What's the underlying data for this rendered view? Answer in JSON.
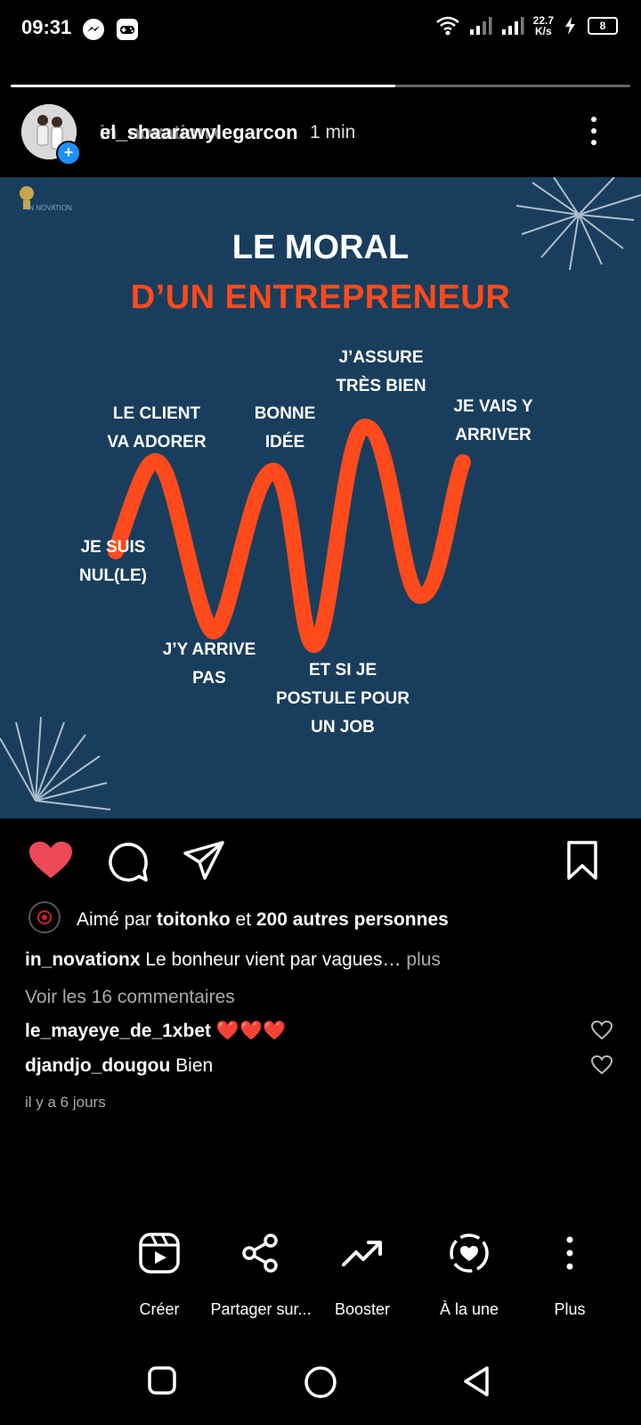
{
  "status_bar": {
    "time": "09:31",
    "speed_value": "22.7",
    "speed_unit": "K/s",
    "battery": "8",
    "left_icons": [
      "messenger-icon",
      "game-controller-icon"
    ],
    "right_icons": [
      "wifi-icon",
      "signal-icon",
      "signal-icon",
      "charging-icon",
      "battery-icon"
    ]
  },
  "story": {
    "progress": 0.62
  },
  "header": {
    "username": "el_shaarawylegarcon",
    "username_overlap": "in_novationx",
    "time_ago": "1 min"
  },
  "post": {
    "title_line1": "LE MORAL",
    "title_line2": "D’UN ENTREPRENEUR",
    "labels": {
      "je_suis_nul": "JE SUIS\nNUL(LE)",
      "le_client": "LE CLIENT\nVA ADORER",
      "jy_arrive_pas": "J’Y ARRIVE\nPAS",
      "bonne_idee": "BONNE\nIDÉE",
      "et_si_je": "ET SI JE\nPOSTULE POUR\nUN JOB",
      "jassure": "J’ASSURE\nTRÈS BIEN",
      "je_vais": "JE VAIS Y\nARRIVER"
    },
    "logo_text": "IN NOVATION"
  },
  "actions": {
    "liked_prefix": "Aimé par ",
    "liked_user": "toitonko",
    "liked_mid": " et ",
    "liked_count": "200 autres personnes",
    "caption_user": "in_novationx",
    "caption_text": " Le bonheur vient par vagues…",
    "caption_more": " plus",
    "view_comments": "Voir les 16 commentaires",
    "comments": [
      {
        "user": "le_mayeye_de_1xbet",
        "text": " ❤️❤️❤️"
      },
      {
        "user": "djandjo_dougou",
        "text": " Bien"
      }
    ],
    "date": "il y a 6 jours"
  },
  "bottom_bar": {
    "items": [
      {
        "label": "Créer"
      },
      {
        "label": "Partager sur..."
      },
      {
        "label": "Booster"
      },
      {
        "label": "À la une"
      },
      {
        "label": "Plus"
      }
    ]
  },
  "colors": {
    "background": "#000000",
    "post_bg": "#193e5d",
    "accent_orange": "#ff4a1c",
    "like_red": "#ed4956",
    "link_blue": "#1e90ff"
  }
}
